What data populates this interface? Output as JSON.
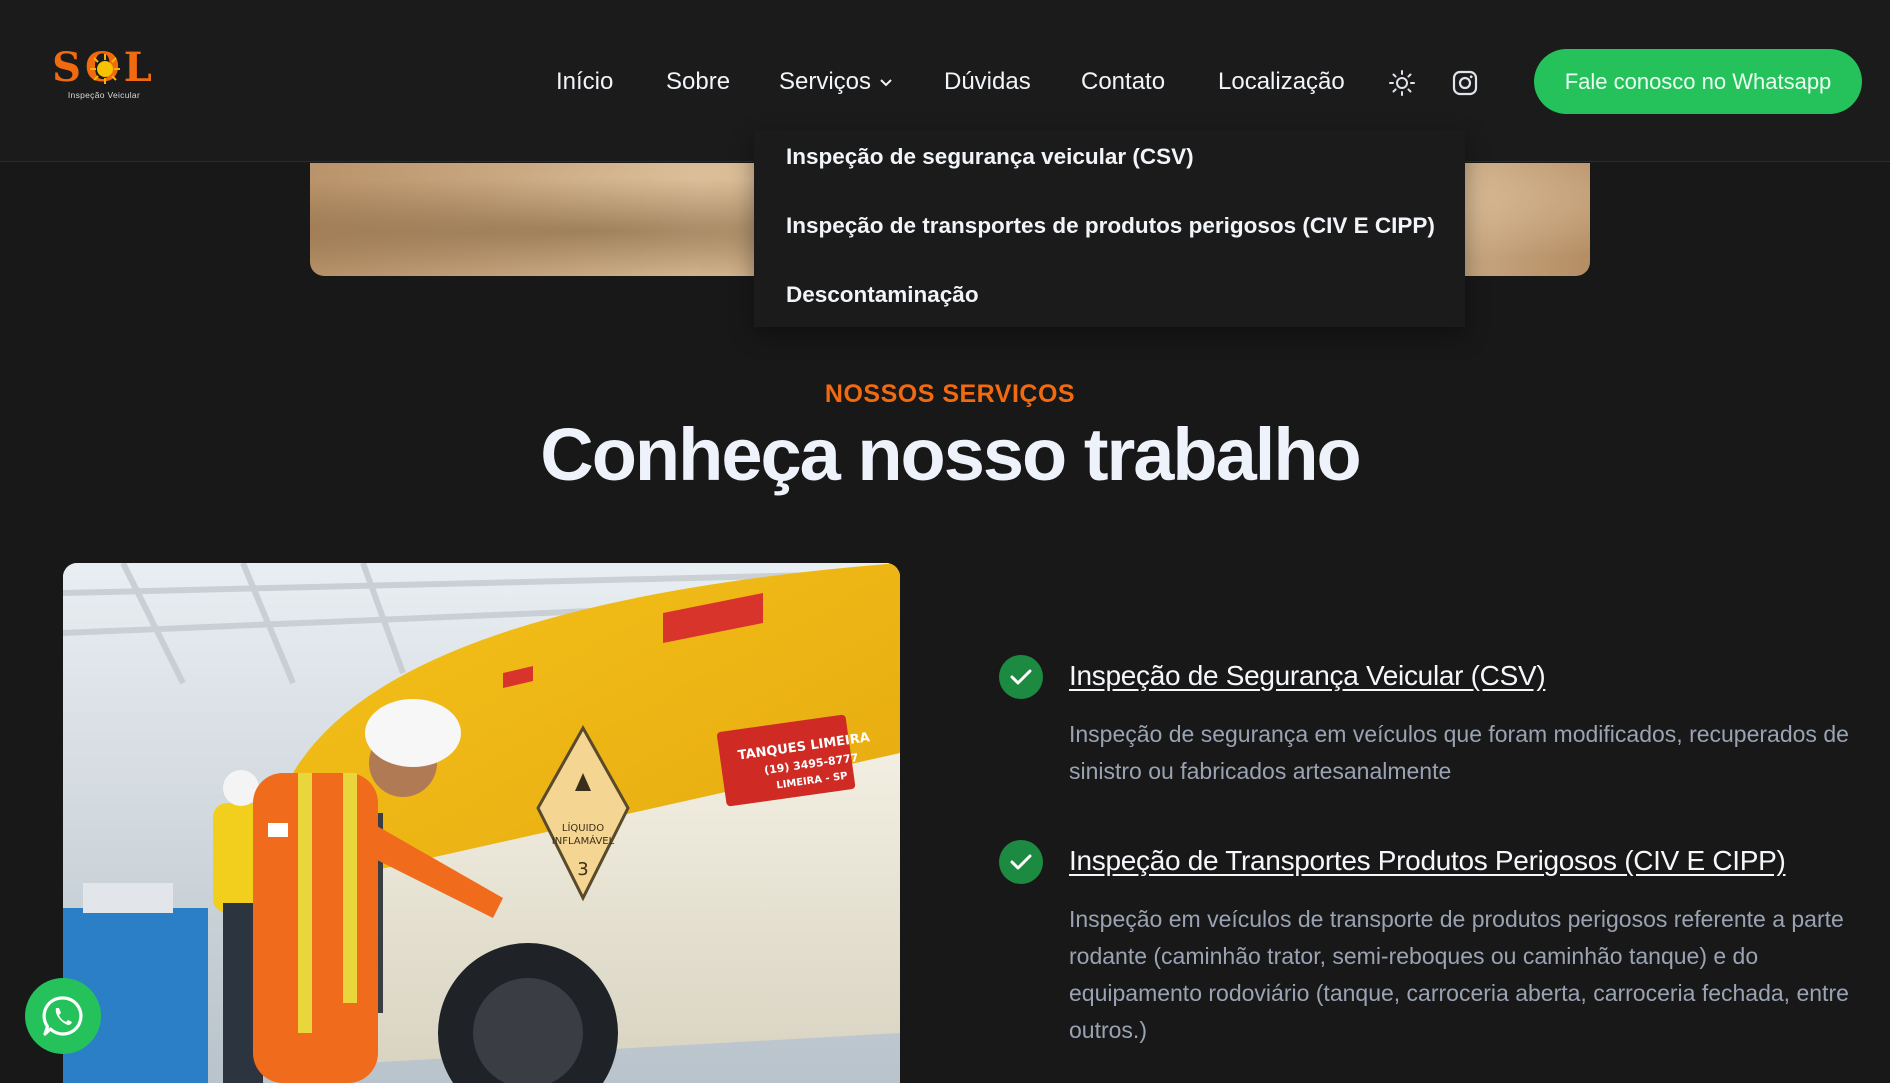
{
  "brand": {
    "logo_word": "SOL",
    "logo_sub": "Inspeção Veicular"
  },
  "nav": {
    "items": [
      "Início",
      "Sobre",
      "Serviços",
      "Dúvidas",
      "Contato",
      "Localização"
    ],
    "cta": "Fale conosco no Whatsapp"
  },
  "dropdown": {
    "items": [
      "Inspeção de segurança veicular (CSV)",
      "Inspeção de transportes de produtos perigosos (CIV E CIPP)",
      "Descontaminação"
    ]
  },
  "section": {
    "eyebrow": "NOSSOS SERVIÇOS",
    "heading": "Conheça nosso trabalho"
  },
  "photo": {
    "sign_line1": "LÍQUIDO",
    "sign_line2": "INFLAMÁVEL",
    "sign_number": "3",
    "plate_line1": "TANQUES LIMEIRA",
    "plate_line2": "(19) 3495-8777",
    "plate_line3": "LIMEIRA - SP"
  },
  "services": [
    {
      "title": "Inspeção de Segurança Veicular (CSV)",
      "desc": "Inspeção de segurança em veículos que foram modificados, recuperados de sinistro ou fabricados artesanalmente"
    },
    {
      "title": "Inspeção de Transportes Produtos Perigosos (CIV E CIPP)",
      "desc": "Inspeção em veículos de transporte de produtos perigosos referente a parte rodante (caminhão trator, semi-reboques ou caminhão tanque) e do equipamento rodoviário (tanque, carroceria aberta, carroceria fechada, entre outros.)"
    }
  ],
  "colors": {
    "accent": "#f26a0f",
    "whatsapp": "#25c25c",
    "check": "#1d8a42",
    "background": "#181818"
  }
}
